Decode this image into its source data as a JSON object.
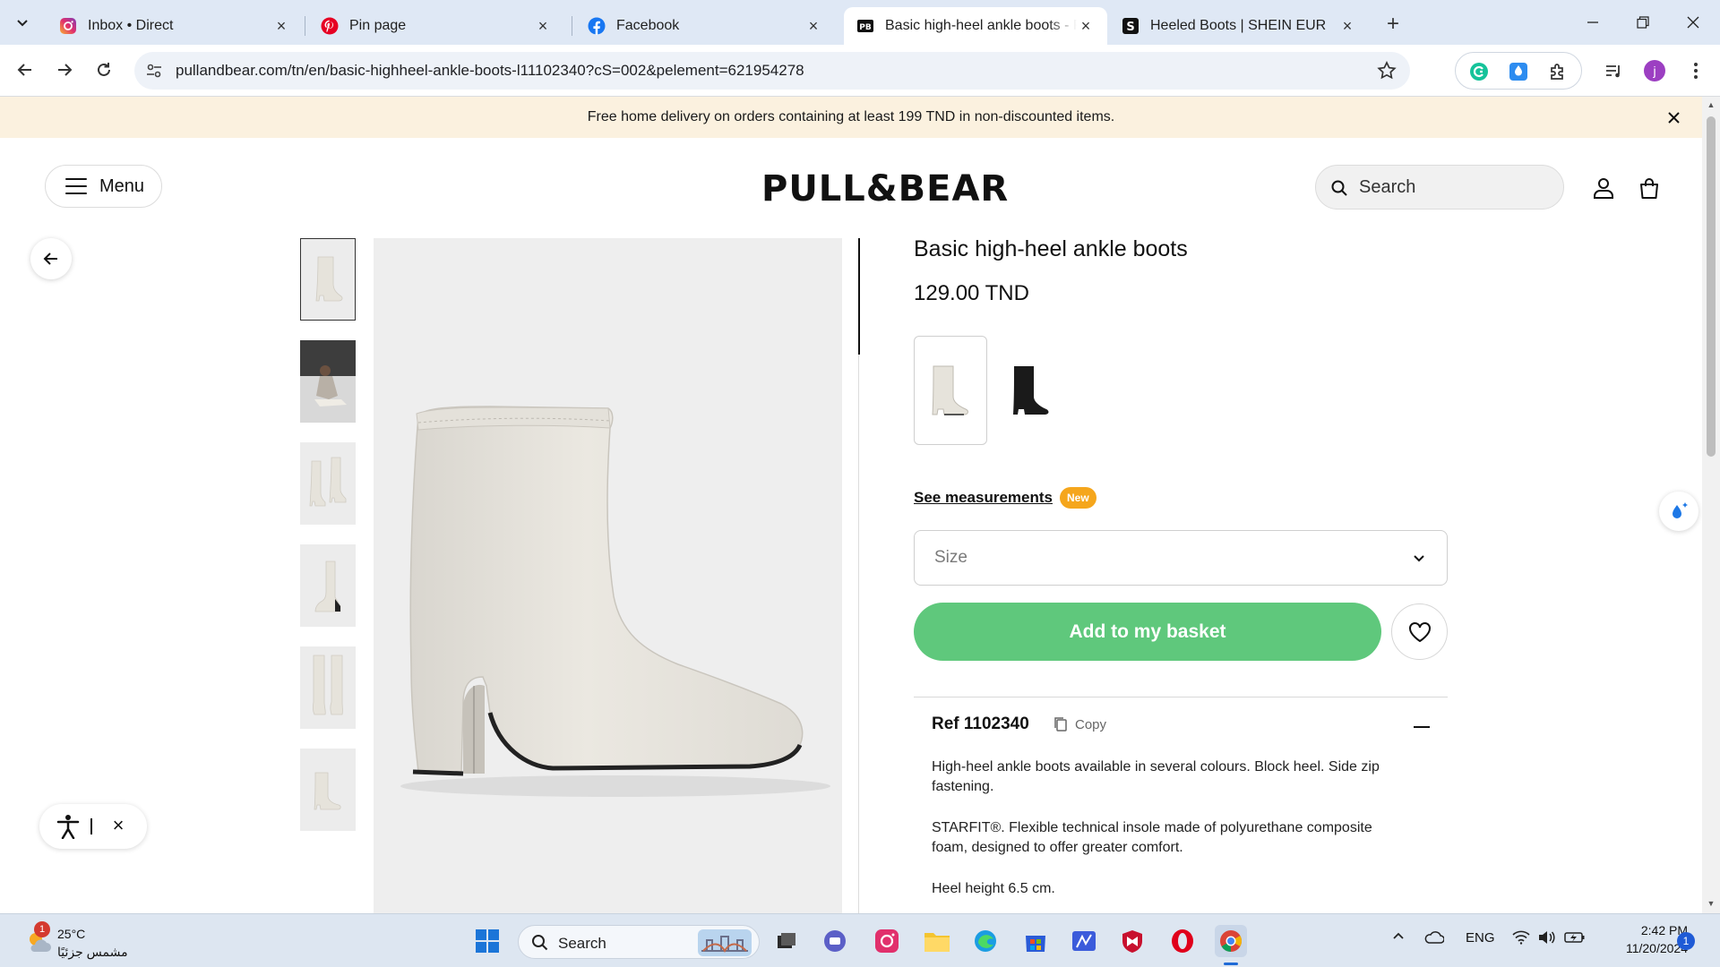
{
  "browser": {
    "tabs": [
      {
        "title": "Inbox • Direct",
        "icon": "instagram-icon"
      },
      {
        "title": "Pin page",
        "icon": "pinterest-icon"
      },
      {
        "title": "Facebook",
        "icon": "facebook-icon"
      },
      {
        "title": "Basic high-heel ankle boots - PULL&BEAR",
        "icon": "pullbear-icon",
        "active": true
      },
      {
        "title": "Heeled Boots | SHEIN EUR",
        "icon": "shein-icon"
      }
    ],
    "url": "pullandbear.com/tn/en/basic-highheel-ankle-boots-l11102340?cS=002&pelement=621954278",
    "profile_initial": "j"
  },
  "page": {
    "promo_text": "Free home delivery on orders containing at least 199 TND in non-discounted items.",
    "menu_label": "Menu",
    "logo_text": "PULL&BEAR",
    "search_placeholder": "Search",
    "product": {
      "title": "Basic high-heel ankle boots",
      "price": "129.00 TND",
      "colors": [
        "ecru",
        "black"
      ],
      "measurements_link": "See measurements",
      "new_badge": "New",
      "size_placeholder": "Size",
      "add_to_basket": "Add to my basket",
      "ref_label": "Ref 1102340",
      "copy_label": "Copy",
      "description": [
        "High-heel ankle boots available in several colours. Block heel. Side zip fastening.",
        "STARFIT®. Flexible technical insole made of polyurethane composite foam, designed to offer greater comfort.",
        "Heel height 6.5 cm."
      ]
    }
  },
  "taskbar": {
    "weather_temp": "25°C",
    "weather_condition": "مشمس جزئيًا",
    "weather_badge": "1",
    "search_label": "Search",
    "language": "ENG",
    "time": "2:42 PM",
    "date": "11/20/2024",
    "notification_count": "1"
  },
  "colors": {
    "basket_green": "#5fc87c",
    "promo_bg": "#fbf1df",
    "new_badge": "#f5a61c"
  }
}
